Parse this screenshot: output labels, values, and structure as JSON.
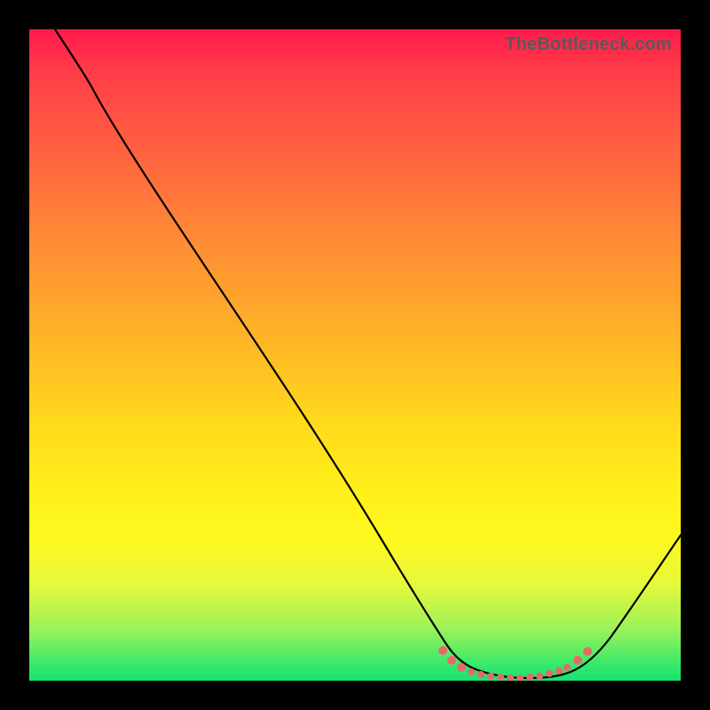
{
  "watermark": "TheBottleneck.com",
  "chart_data": {
    "type": "line",
    "title": "",
    "xlabel": "",
    "ylabel": "",
    "xlim": [
      0,
      100
    ],
    "ylim": [
      0,
      100
    ],
    "grid": false,
    "series": [
      {
        "name": "bottleneck-curve",
        "x": [
          4,
          10,
          20,
          30,
          40,
          50,
          58,
          62,
          66,
          70,
          74,
          78,
          82,
          86,
          90,
          100
        ],
        "y": [
          100,
          92,
          77,
          62,
          48,
          33,
          20,
          12,
          6,
          2,
          0,
          0,
          0,
          3,
          10,
          30
        ]
      }
    ],
    "markers": {
      "name": "highlighted-minimum",
      "x": [
        62,
        64,
        66,
        68,
        70,
        72,
        74,
        76,
        78,
        80,
        82,
        84,
        86
      ],
      "y": [
        6,
        4,
        2.5,
        1.5,
        1,
        0.5,
        0.3,
        0.3,
        0.5,
        1,
        1.8,
        3,
        5
      ]
    }
  }
}
